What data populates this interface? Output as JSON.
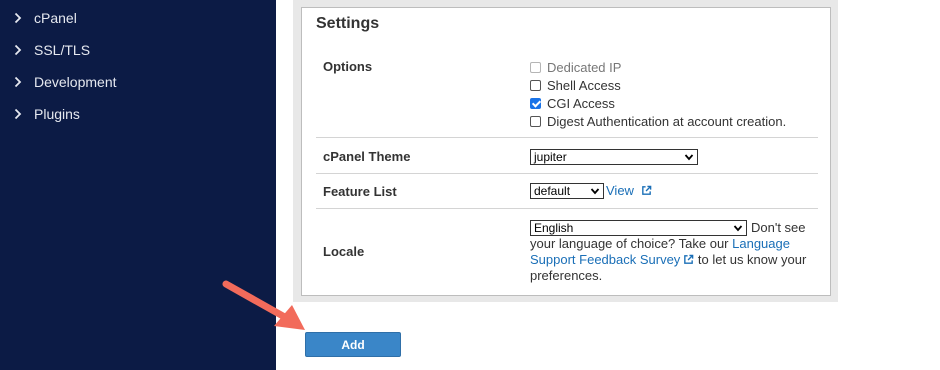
{
  "sidebar": {
    "items": [
      {
        "label": "cPanel"
      },
      {
        "label": "SSL/TLS"
      },
      {
        "label": "Development"
      },
      {
        "label": "Plugins"
      }
    ]
  },
  "settings": {
    "title": "Settings",
    "options": {
      "label": "Options",
      "items": [
        {
          "label": "Dedicated IP",
          "checked": false,
          "disabled": true
        },
        {
          "label": "Shell Access",
          "checked": false,
          "disabled": false
        },
        {
          "label": "CGI Access",
          "checked": true,
          "disabled": false
        },
        {
          "label": "Digest Authentication at account creation.",
          "checked": false,
          "disabled": false
        }
      ]
    },
    "theme": {
      "label": "cPanel Theme",
      "value": "jupiter"
    },
    "feature_list": {
      "label": "Feature List",
      "value": "default",
      "view_link": "View"
    },
    "locale": {
      "label": "Locale",
      "value": "English",
      "help_before": "Don't see your language of choice? Take our ",
      "help_link": "Language Support Feedback Survey",
      "help_after": " to let us know your preferences."
    }
  },
  "actions": {
    "add_label": "Add"
  },
  "colors": {
    "sidebar_bg": "#0c1b45",
    "button_bg": "#3a86c8",
    "link": "#1a6fb7",
    "annotation_arrow": "#f26b5b"
  }
}
